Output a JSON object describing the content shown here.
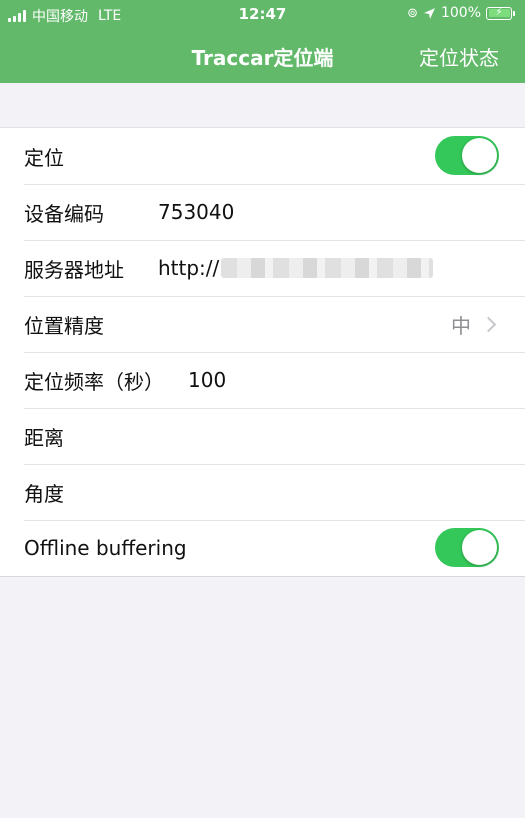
{
  "status_bar": {
    "carrier": "中国移动",
    "network": "LTE",
    "time": "12:47",
    "battery": "100%"
  },
  "nav": {
    "title": "Traccar定位端",
    "right_button": "定位状态"
  },
  "rows": [
    {
      "label": "定位",
      "toggle": true
    },
    {
      "label": "设备编码",
      "value": "753040"
    },
    {
      "label": "服务器地址",
      "value": "http://"
    },
    {
      "label": "位置精度",
      "value": "中"
    },
    {
      "label": "定位频率（秒）",
      "value": "100"
    },
    {
      "label": "距离",
      "value": ""
    },
    {
      "label": "角度",
      "value": ""
    },
    {
      "label": "Offline buffering",
      "toggle": true
    }
  ],
  "colors": {
    "header": "#62b96a",
    "toggle_on": "#34c759",
    "background": "#f2f2f7"
  }
}
